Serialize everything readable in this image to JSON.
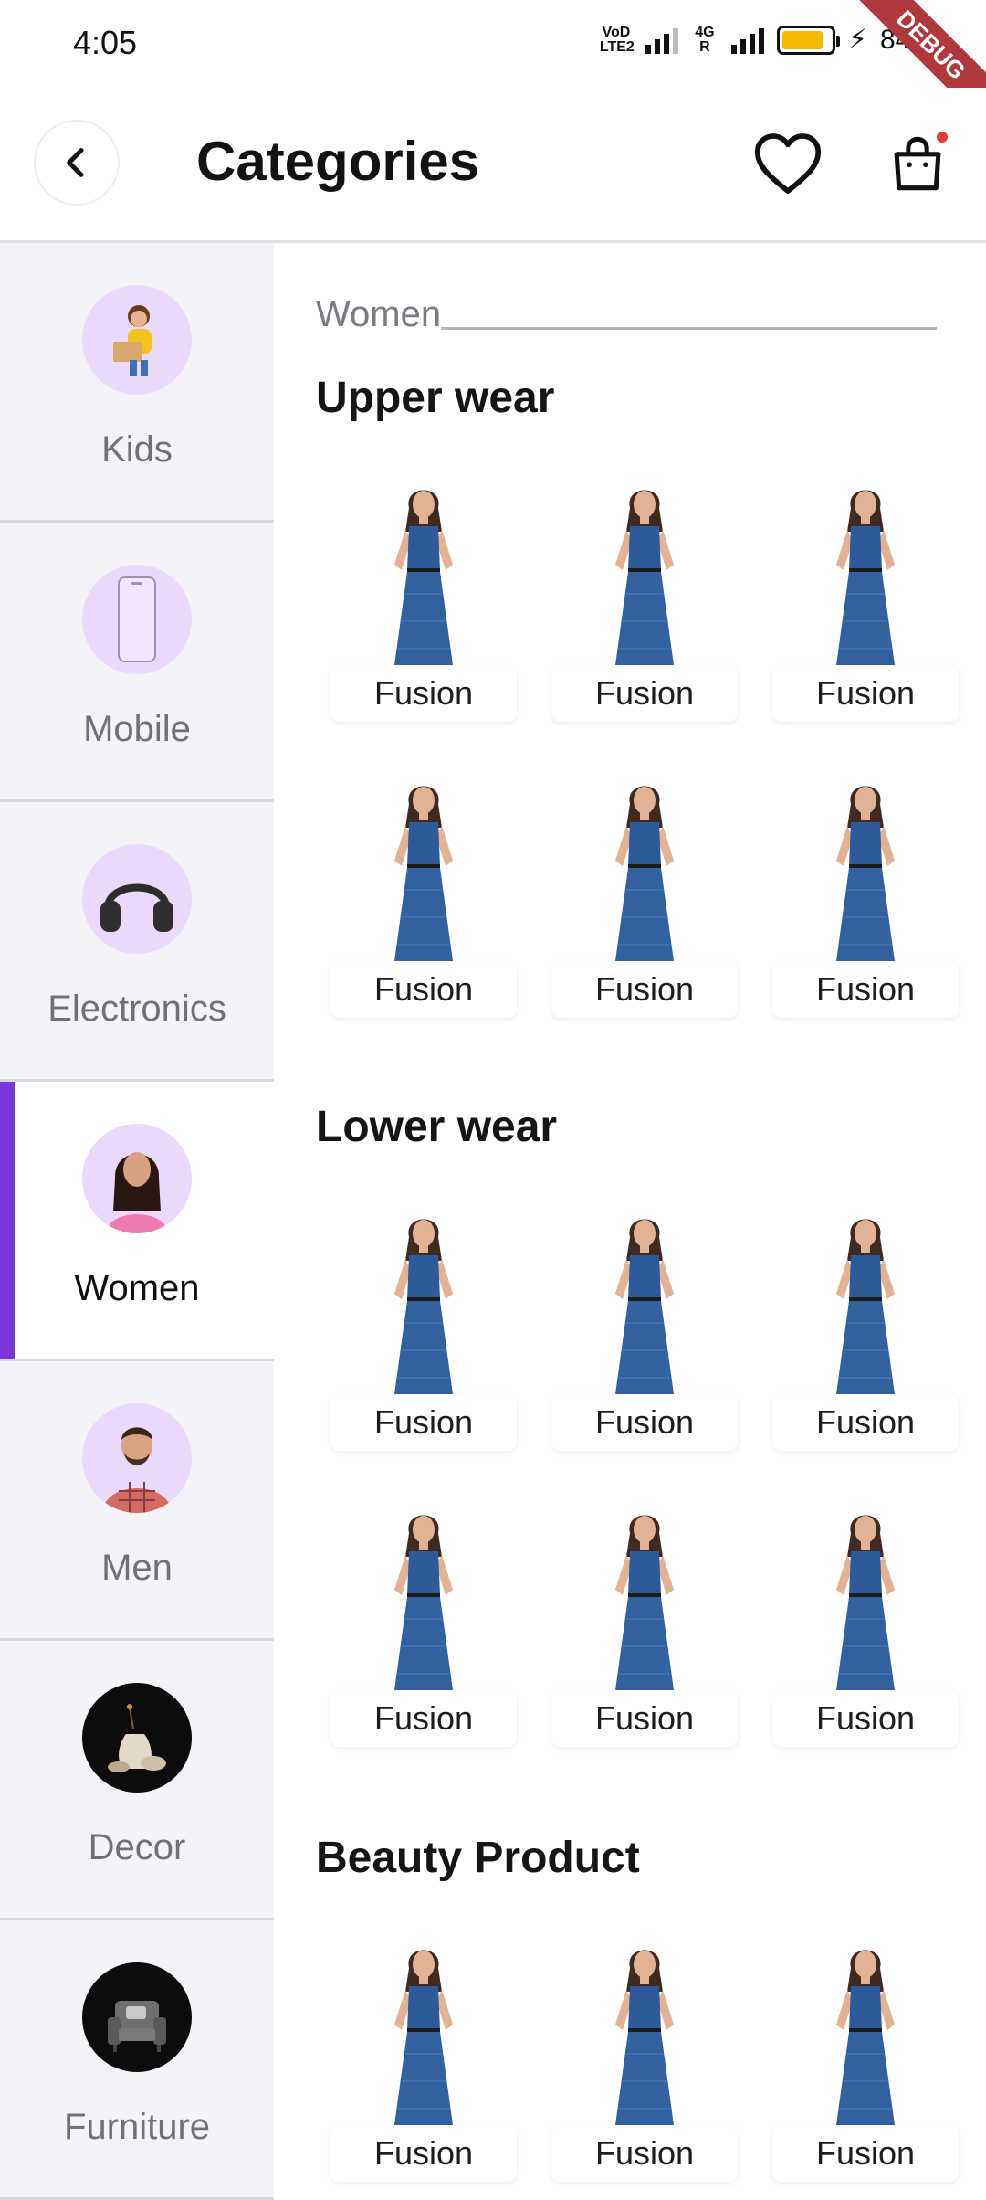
{
  "status_bar": {
    "time": "4:05",
    "network_label_1": "VoD LTE2",
    "network_label_2": "4G R",
    "battery_percent": "84%",
    "debug_banner": "DEBUG"
  },
  "app_bar": {
    "title": "Categories",
    "icons": {
      "back": "chevron-left-icon",
      "favorite": "heart-icon",
      "cart": "shopping-bag-icon"
    }
  },
  "sidebar": {
    "active_index": 3,
    "accent_color": "#7b36d9",
    "items": [
      {
        "label": "Kids"
      },
      {
        "label": "Mobile"
      },
      {
        "label": "Electronics"
      },
      {
        "label": "Women"
      },
      {
        "label": "Men"
      },
      {
        "label": "Decor"
      },
      {
        "label": "Furniture"
      }
    ]
  },
  "content": {
    "section_label": "Women",
    "groups": [
      {
        "title": "Upper wear",
        "products": [
          {
            "label": "Fusion"
          },
          {
            "label": "Fusion"
          },
          {
            "label": "Fusion"
          },
          {
            "label": "Fusion"
          },
          {
            "label": "Fusion"
          },
          {
            "label": "Fusion"
          }
        ]
      },
      {
        "title": "Lower wear",
        "products": [
          {
            "label": "Fusion"
          },
          {
            "label": "Fusion"
          },
          {
            "label": "Fusion"
          },
          {
            "label": "Fusion"
          },
          {
            "label": "Fusion"
          },
          {
            "label": "Fusion"
          }
        ]
      },
      {
        "title": "Beauty Product",
        "products": [
          {
            "label": "Fusion"
          },
          {
            "label": "Fusion"
          },
          {
            "label": "Fusion"
          }
        ]
      }
    ]
  }
}
